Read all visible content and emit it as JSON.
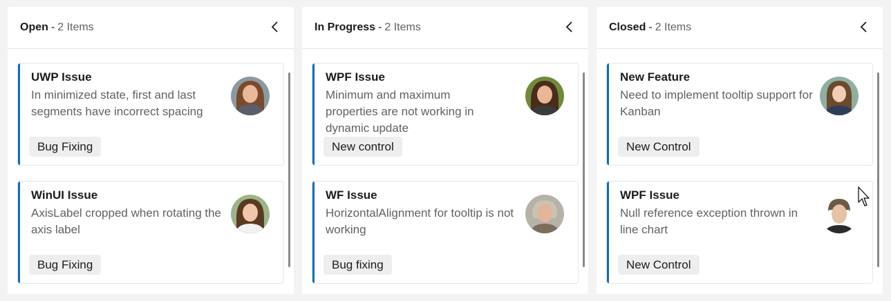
{
  "columns": [
    {
      "title": "Open",
      "separator": "-",
      "count": "2 Items",
      "cards": [
        {
          "title": "UWP Issue",
          "description": "In minimized state, first and last segments have incorrect spacing",
          "tag": "Bug Fixing",
          "avatar": "woman-avatar-1"
        },
        {
          "title": "WinUI Issue",
          "description": "AxisLabel cropped when rotating the axis label",
          "tag": "Bug Fixing",
          "avatar": "woman-avatar-2"
        }
      ]
    },
    {
      "title": "In Progress",
      "separator": "-",
      "count": "2 Items",
      "cards": [
        {
          "title": "WPF Issue",
          "description": "Minimum and maximum properties are not working in dynamic update",
          "tag": "New control",
          "avatar": "woman-avatar-3"
        },
        {
          "title": "WF Issue",
          "description": "HorizontalAlignment for tooltip is not working",
          "tag": "Bug fixing",
          "avatar": "woman-avatar-4"
        }
      ]
    },
    {
      "title": "Closed",
      "separator": "-",
      "count": "2 Items",
      "cards": [
        {
          "title": "New Feature",
          "description": "Need to implement tooltip support for Kanban",
          "tag": "New Control",
          "avatar": "woman-avatar-5"
        },
        {
          "title": "WPF Issue",
          "description": "Null reference exception thrown in line chart",
          "tag": "New Control",
          "avatar": "man-avatar-1"
        }
      ]
    }
  ],
  "colors": {
    "accent": "#0f6cbd",
    "background": "#f3f3f3",
    "tag_bg": "#eeeeee"
  }
}
